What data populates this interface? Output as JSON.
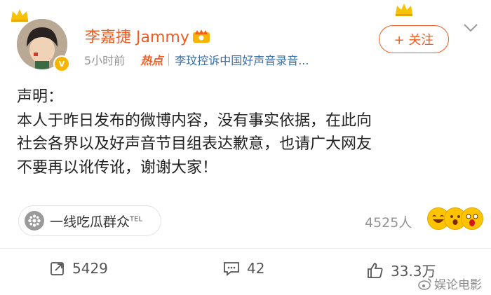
{
  "header": {
    "username": "李嘉捷 Jammy",
    "time": "5小时前",
    "hot_label": "热点",
    "topic": "李玟控诉中国好声音录音...",
    "follow_label": "+ 关注",
    "verified_badge": "V"
  },
  "post": {
    "lines": [
      "声明：",
      "本人于昨日发布的微博内容，没有事实依据，在此向",
      "社会各界以及好声音节目组表达歉意，也请广大网友",
      "不要再以讹传讹，谢谢大家！"
    ]
  },
  "source": {
    "name": "一线吃瓜群众",
    "suffix": "TEL"
  },
  "reactions": {
    "count": "4525人"
  },
  "actions": {
    "repost": "5429",
    "comment": "42",
    "like": "33.3万"
  },
  "watermark": {
    "text": "娱论电影"
  },
  "colors": {
    "accent": "#f25c22",
    "topic": "#3a6ea5",
    "muted": "#939393"
  }
}
